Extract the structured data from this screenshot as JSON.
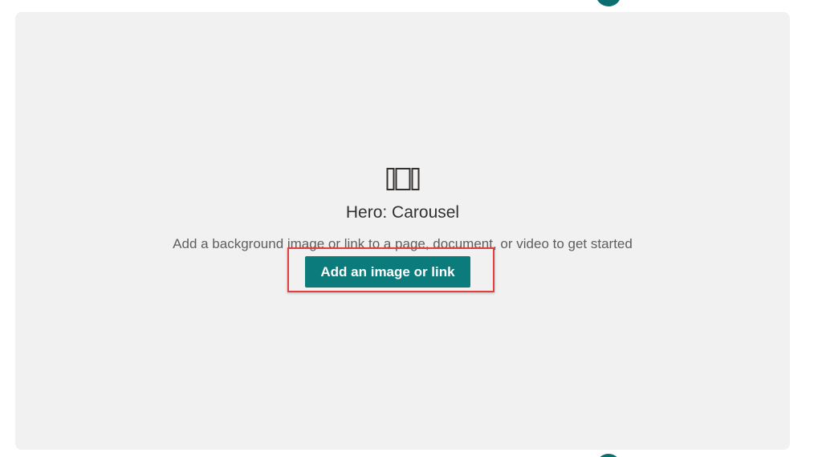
{
  "webpart": {
    "icon": "carousel-icon",
    "title": "Hero: Carousel",
    "description": "Add a background image or link to a page, document, or video to get started",
    "button_label": "Add an image or link"
  },
  "colors": {
    "accent": "#0c7b7b",
    "highlight": "#e2403f",
    "background": "#f1f1f1"
  }
}
